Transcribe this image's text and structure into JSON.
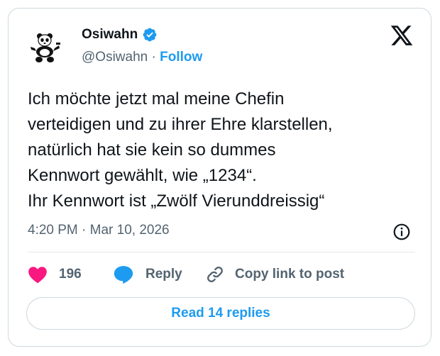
{
  "author": {
    "name": "Osiwahn",
    "handle": "@Osiwahn",
    "separator": "·",
    "follow_label": "Follow",
    "avatar_icon": "panda-avatar",
    "verified_icon": "verified-badge-icon"
  },
  "brand_icon": "x-logo-icon",
  "tweet": {
    "lines": [
      "Ich möchte jetzt mal meine Chefin",
      "verteidigen und zu ihrer Ehre klarstellen,",
      "natürlich hat sie kein so dummes",
      "Kennwort gewählt, wie „1234“.",
      "Ihr Kennwort ist „Zwölf Vierunddreissig“"
    ]
  },
  "meta": {
    "time": "4:20 PM",
    "separator": "·",
    "date": "Mar 10, 2026",
    "info_icon": "info-icon"
  },
  "actions": {
    "likes_count": "196",
    "reply_label": "Reply",
    "copy_label": "Copy link to post"
  },
  "read_replies_label": "Read 14 replies",
  "colors": {
    "accent": "#1d9bf0",
    "heart": "#f91880",
    "text": "#0f1419",
    "muted": "#536471",
    "border": "#cfd9de"
  }
}
